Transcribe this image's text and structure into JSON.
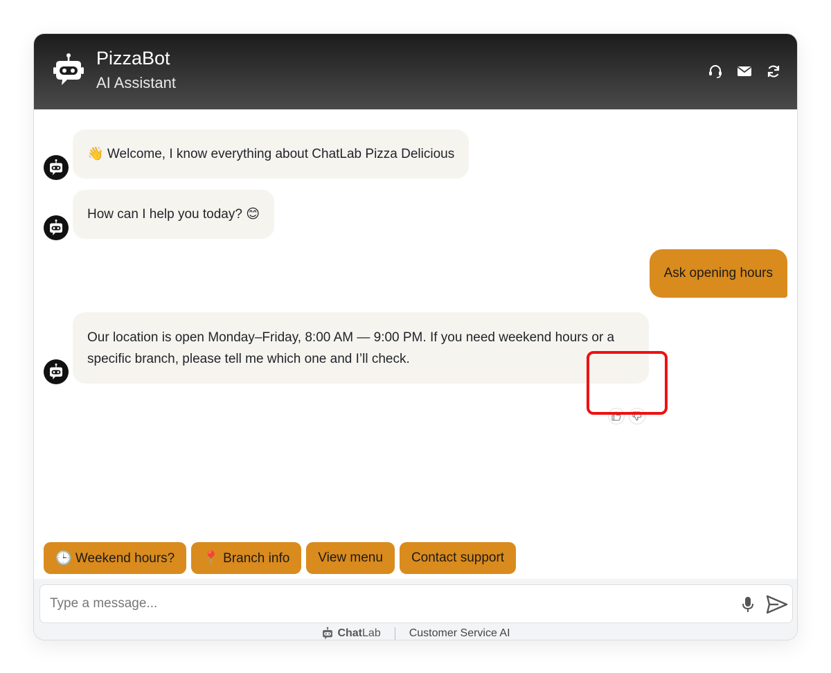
{
  "header": {
    "title": "PizzaBot",
    "subtitle": "AI Assistant",
    "icons": [
      "headset-icon",
      "mail-icon",
      "refresh-icon"
    ]
  },
  "messages": [
    {
      "sender": "bot",
      "text": "👋 Welcome, I know everything about ChatLab Pizza Delicious"
    },
    {
      "sender": "bot",
      "text": "How can I help you today? 😊"
    },
    {
      "sender": "user",
      "text": "Ask opening hours"
    },
    {
      "sender": "bot",
      "text": "Our location is open Monday–Friday, 8:00 AM — 9:00 PM. If you need weekend hours or a specific branch, please tell me which one and I’ll check."
    }
  ],
  "quick_replies": [
    "🕒 Weekend hours?",
    "📍 Branch info",
    "View menu",
    "Contact support"
  ],
  "input": {
    "placeholder": "Type a message...",
    "value": ""
  },
  "footer": {
    "brand_chat": "Chat",
    "brand_lab": "Lab",
    "tagline": "Customer Service AI"
  },
  "colors": {
    "accent": "#d98b1e",
    "header_top": "#1c1c1c",
    "header_bottom": "#4a4a4a",
    "bot_bubble": "#f6f4ef",
    "highlight": "#ee1111"
  }
}
